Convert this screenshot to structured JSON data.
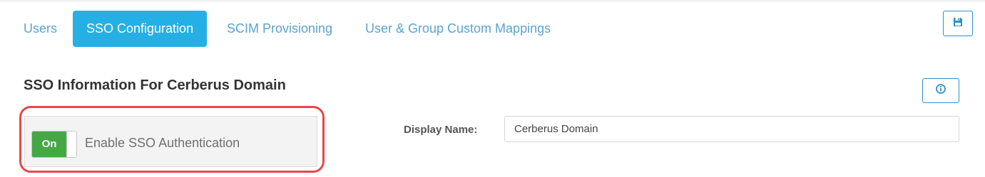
{
  "tabs": [
    {
      "label": "Users",
      "active": false
    },
    {
      "label": "SSO Configuration",
      "active": true
    },
    {
      "label": "SCIM Provisioning",
      "active": false
    },
    {
      "label": "User & Group Custom Mappings",
      "active": false
    }
  ],
  "toolbar": {
    "save_icon": "save-icon"
  },
  "section": {
    "title": "SSO Information For Cerberus Domain",
    "info_icon": "info-icon"
  },
  "sso": {
    "toggle_state": "On",
    "label": "Enable SSO Authentication"
  },
  "display_name": {
    "label": "Display Name:",
    "value": "Cerberus Domain"
  },
  "colors": {
    "accent": "#24b0e4",
    "tab_link": "#5aa4cf",
    "toggle_on": "#45a845",
    "highlight": "#e8474c"
  }
}
